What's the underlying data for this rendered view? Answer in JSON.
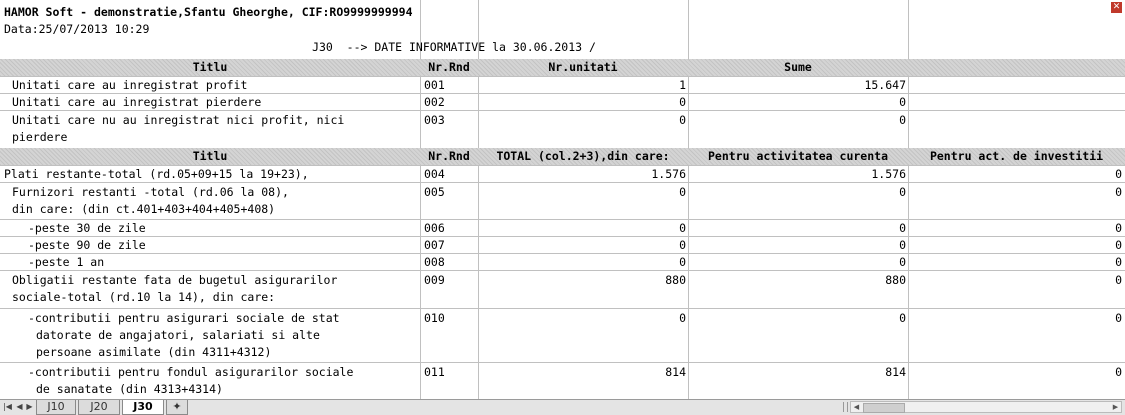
{
  "company_line": "HAMOR Soft - demonstratie,Sfantu Gheorghe, CIF:RO9999999994",
  "date_line": "Data:25/07/2013 10:29",
  "report_title": "J30  --> DATE INFORMATIVE la 30.06.2013 /",
  "table1": {
    "headers": [
      "Titlu",
      "Nr.Rnd",
      "Nr.unitati",
      "Sume"
    ],
    "rows": [
      {
        "title": [
          "Unitati care au inregistrat profit"
        ],
        "nr": "001",
        "units": "1",
        "sum": "15.647"
      },
      {
        "title": [
          "Unitati care au inregistrat pierdere"
        ],
        "nr": "002",
        "units": "0",
        "sum": "0"
      },
      {
        "title": [
          "Unitati care nu au inregistrat nici profit, nici",
          "pierdere"
        ],
        "nr": "003",
        "units": "0",
        "sum": "0"
      }
    ]
  },
  "table2": {
    "headers": [
      "Titlu",
      "Nr.Rnd",
      "TOTAL (col.2+3),din care:",
      "Pentru activitatea curenta",
      "Pentru act. de investitii"
    ],
    "rows": [
      {
        "title": [
          "Plati restante-total (rd.05+09+15 la 19+23),"
        ],
        "nr": "004",
        "total": "1.576",
        "curr": "1.576",
        "inv": "0"
      },
      {
        "title": [
          "Furnizori restanti -total (rd.06 la 08),",
          "din care: (din ct.401+403+404+405+408)"
        ],
        "nr": "005",
        "total": "0",
        "curr": "0",
        "inv": "0"
      },
      {
        "title": [
          "-peste 30 de zile"
        ],
        "nr": "006",
        "total": "0",
        "curr": "0",
        "inv": "0"
      },
      {
        "title": [
          "-peste 90 de zile"
        ],
        "nr": "007",
        "total": "0",
        "curr": "0",
        "inv": "0"
      },
      {
        "title": [
          "-peste 1 an"
        ],
        "nr": "008",
        "total": "0",
        "curr": "0",
        "inv": "0"
      },
      {
        "title": [
          "Obligatii restante fata de bugetul asigurarilor",
          "sociale-total (rd.10 la 14), din care:"
        ],
        "nr": "009",
        "total": "880",
        "curr": "880",
        "inv": "0"
      },
      {
        "title": [
          "-contributii pentru asigurari sociale de stat",
          "datorate de angajatori, salariati si alte",
          "persoane asimilate (din 4311+4312)"
        ],
        "nr": "010",
        "total": "0",
        "curr": "0",
        "inv": "0"
      },
      {
        "title": [
          "-contributii pentru fondul asigurarilor sociale",
          "de sanatate (din 4313+4314)"
        ],
        "nr": "011",
        "total": "814",
        "curr": "814",
        "inv": "0"
      }
    ]
  },
  "sheet_tabs": [
    "J10",
    "J20",
    "J30"
  ],
  "active_tab": "J30",
  "icons": {
    "close": "close-icon",
    "new_sheet": "insert-sheet-icon"
  }
}
